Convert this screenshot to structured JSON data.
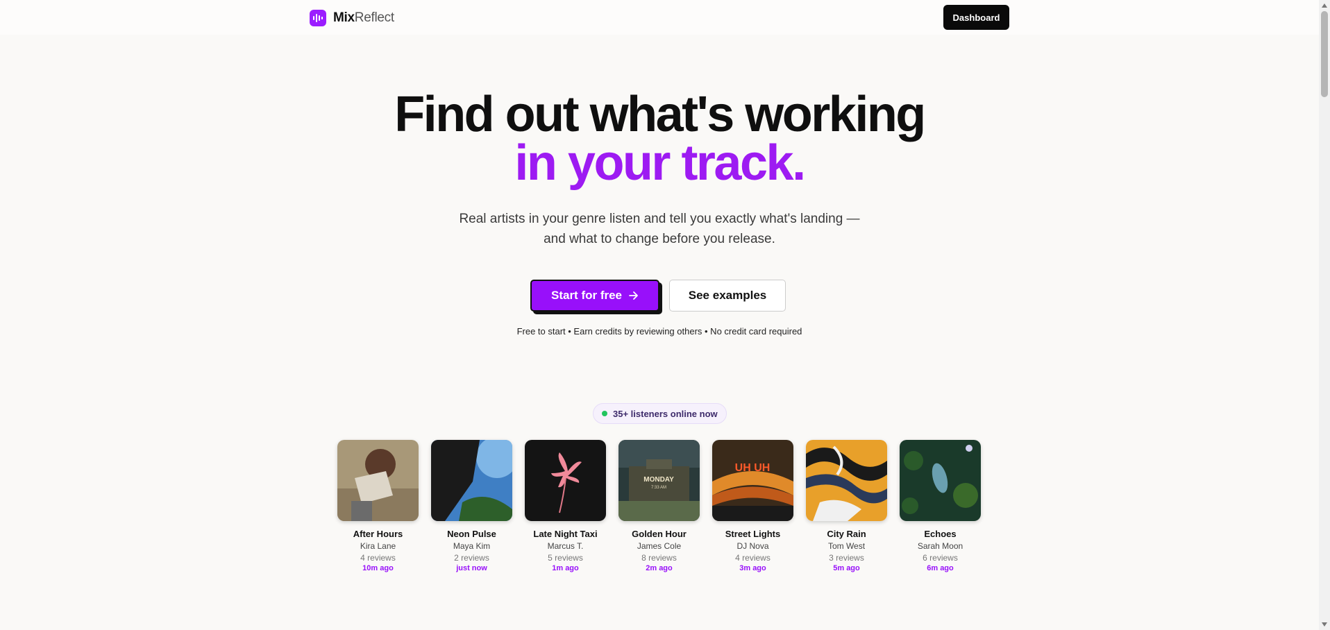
{
  "header": {
    "logo_mix": "Mix",
    "logo_reflect": "Reflect",
    "dashboard_label": "Dashboard"
  },
  "hero": {
    "title_line1": "Find out what's working",
    "title_line2": "in your track.",
    "subtitle_line1": "Real artists in your genre listen and tell you exactly what's landing —",
    "subtitle_line2": "and what to change before you release.",
    "primary_label": "Start for free",
    "secondary_label": "See examples",
    "fine_print": "Free to start • Earn credits by reviewing others • No credit card required"
  },
  "online": {
    "label": "35+ listeners online now"
  },
  "tracks": [
    {
      "title": "After Hours",
      "artist": "Kira Lane",
      "reviews": "4 reviews",
      "time": "10m ago"
    },
    {
      "title": "Neon Pulse",
      "artist": "Maya Kim",
      "reviews": "2 reviews",
      "time": "just now"
    },
    {
      "title": "Late Night Taxi",
      "artist": "Marcus T.",
      "reviews": "5 reviews",
      "time": "1m ago"
    },
    {
      "title": "Golden Hour",
      "artist": "James Cole",
      "reviews": "8 reviews",
      "time": "2m ago"
    },
    {
      "title": "Street Lights",
      "artist": "DJ Nova",
      "reviews": "4 reviews",
      "time": "3m ago"
    },
    {
      "title": "City Rain",
      "artist": "Tom West",
      "reviews": "3 reviews",
      "time": "5m ago"
    },
    {
      "title": "Echoes",
      "artist": "Sarah Moon",
      "reviews": "6 reviews",
      "time": "6m ago"
    }
  ],
  "cover_art": {
    "golden_hour_text1": "MONDAY",
    "golden_hour_text2": "7:33 AM",
    "street_lights_text": "UH UH"
  },
  "colors": {
    "accent": "#9810fa",
    "headline_accent": "#9d1bf2",
    "online_dot": "#22c55e"
  }
}
